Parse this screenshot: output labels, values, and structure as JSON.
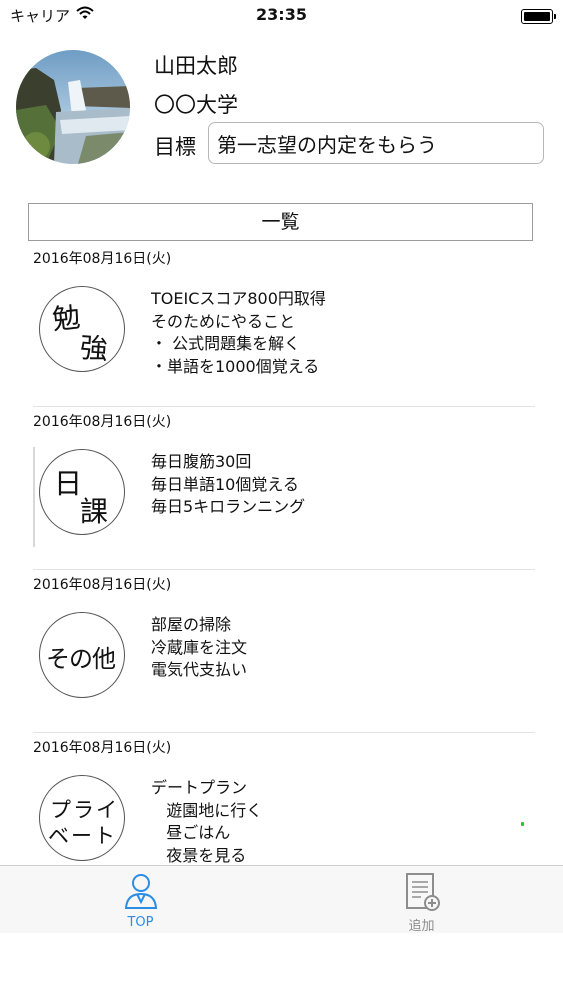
{
  "status": {
    "carrier": "キャリア",
    "time": "23:35"
  },
  "profile": {
    "name": "山田太郎",
    "university": "〇〇大学",
    "goal_label": "目標",
    "goal_value": "第一志望の内定をもらう"
  },
  "list_button": "一覧",
  "entries": [
    {
      "date": "2016年08月16日(火)",
      "badge": [
        "勉",
        "強"
      ],
      "lines": [
        "TOEICスコア800円取得",
        "そのためにやること",
        "・ 公式問題集を解く",
        "・単語を1000個覚える"
      ]
    },
    {
      "date": "2016年08月16日(火)",
      "badge": [
        "日",
        "課"
      ],
      "lines": [
        "毎日腹筋30回",
        "毎日単語10個覚える",
        "毎日5キロランニング"
      ]
    },
    {
      "date": "2016年08月16日(火)",
      "badge": [
        "その他"
      ],
      "lines": [
        "部屋の掃除",
        "冷蔵庫を注文",
        "電気代支払い"
      ]
    },
    {
      "date": "2016年08月16日(火)",
      "badge": [
        "プライ",
        "ベート"
      ],
      "lines": [
        "デートプラン",
        "   遊園地に行く",
        "   昼ごはん",
        "   夜景を見る"
      ]
    }
  ],
  "tabs": [
    {
      "label": "TOP",
      "icon": "person-icon",
      "active": true
    },
    {
      "label": "追加",
      "icon": "add-document-icon",
      "active": false
    }
  ],
  "colors": {
    "accent": "#2a8de6",
    "inactive": "#8d8d8d"
  }
}
